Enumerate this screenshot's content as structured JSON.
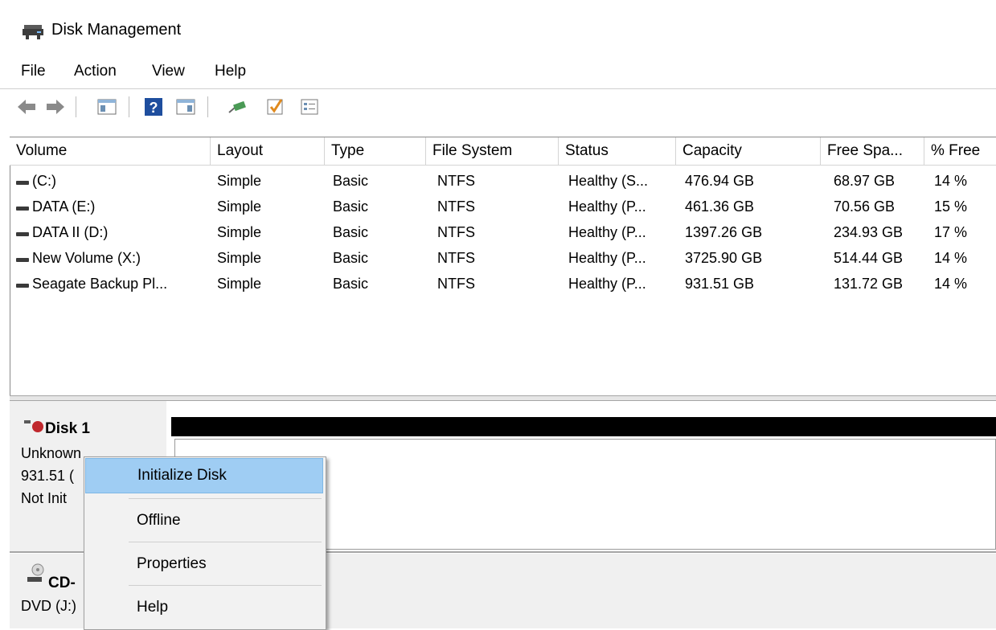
{
  "window": {
    "title": "Disk Management"
  },
  "menu": [
    {
      "label": "File"
    },
    {
      "label": "Action"
    },
    {
      "label": "View"
    },
    {
      "label": "Help"
    }
  ],
  "toolbar": {
    "buttons": [
      "back-arrow-icon",
      "forward-arrow-icon",
      "console-tree-icon",
      "help-icon",
      "action-pane-icon",
      "connect-disk-icon",
      "checkmark-icon",
      "properties-icon"
    ]
  },
  "volume_list": {
    "columns": [
      "Volume",
      "Layout",
      "Type",
      "File System",
      "Status",
      "Capacity",
      "Free Spa...",
      "% Free"
    ],
    "rows": [
      {
        "volume": "(C:)",
        "layout": "Simple",
        "type": "Basic",
        "fs": "NTFS",
        "status": "Healthy (S...",
        "capacity": "476.94 GB",
        "free": "68.97 GB",
        "pct": "14 %"
      },
      {
        "volume": "DATA (E:)",
        "layout": "Simple",
        "type": "Basic",
        "fs": "NTFS",
        "status": "Healthy (P...",
        "capacity": "461.36 GB",
        "free": "70.56 GB",
        "pct": "15 %"
      },
      {
        "volume": "DATA II (D:)",
        "layout": "Simple",
        "type": "Basic",
        "fs": "NTFS",
        "status": "Healthy (P...",
        "capacity": "1397.26 GB",
        "free": "234.93 GB",
        "pct": "17 %"
      },
      {
        "volume": "New Volume (X:)",
        "layout": "Simple",
        "type": "Basic",
        "fs": "NTFS",
        "status": "Healthy (P...",
        "capacity": "3725.90 GB",
        "free": "514.44 GB",
        "pct": "14 %"
      },
      {
        "volume": "Seagate Backup Pl...",
        "layout": "Simple",
        "type": "Basic",
        "fs": "NTFS",
        "status": "Healthy (P...",
        "capacity": "931.51 GB",
        "free": "131.72 GB",
        "pct": "14 %"
      }
    ]
  },
  "disks": {
    "disk1": {
      "name": "Disk 1",
      "line1": "Unknown",
      "line2": "931.51 (",
      "line3": "Not Init"
    },
    "cd": {
      "name": "CD-",
      "line1": "DVD (J:)"
    }
  },
  "context_menu": {
    "items": [
      {
        "label": "Initialize Disk",
        "highlighted": true
      },
      {
        "label": "Offline"
      },
      {
        "label": "Properties"
      },
      {
        "label": "Help"
      }
    ]
  },
  "colors": {
    "highlight": "#9fcdf3",
    "offline_status": "#c0282d"
  }
}
